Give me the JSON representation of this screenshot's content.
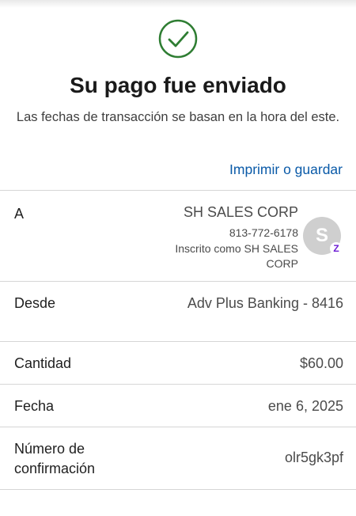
{
  "header": {
    "title": "Su pago fue enviado",
    "subtitle": "Las fechas de transacción se basan en la hora del este.",
    "print_link": "Imprimir o guardar",
    "success_icon": "check-circle-icon",
    "success_color": "#2e7d32",
    "link_color": "#0a5aa8"
  },
  "details": {
    "to": {
      "label": "A",
      "name": "SH SALES CORP",
      "phone": "813-772-6178",
      "enrolled": "Inscrito como SH SALES CORP",
      "avatar_letter": "S",
      "badge_icon": "zelle-icon",
      "badge_glyph": "Z",
      "badge_color": "#6d1ed4"
    },
    "from": {
      "label": "Desde",
      "value": "Adv Plus Banking - 8416"
    },
    "amount": {
      "label": "Cantidad",
      "value": "$60.00"
    },
    "date": {
      "label": "Fecha",
      "value": "ene 6, 2025"
    },
    "confirmation": {
      "label": "Número de confirmación",
      "value": "olr5gk3pf"
    }
  }
}
